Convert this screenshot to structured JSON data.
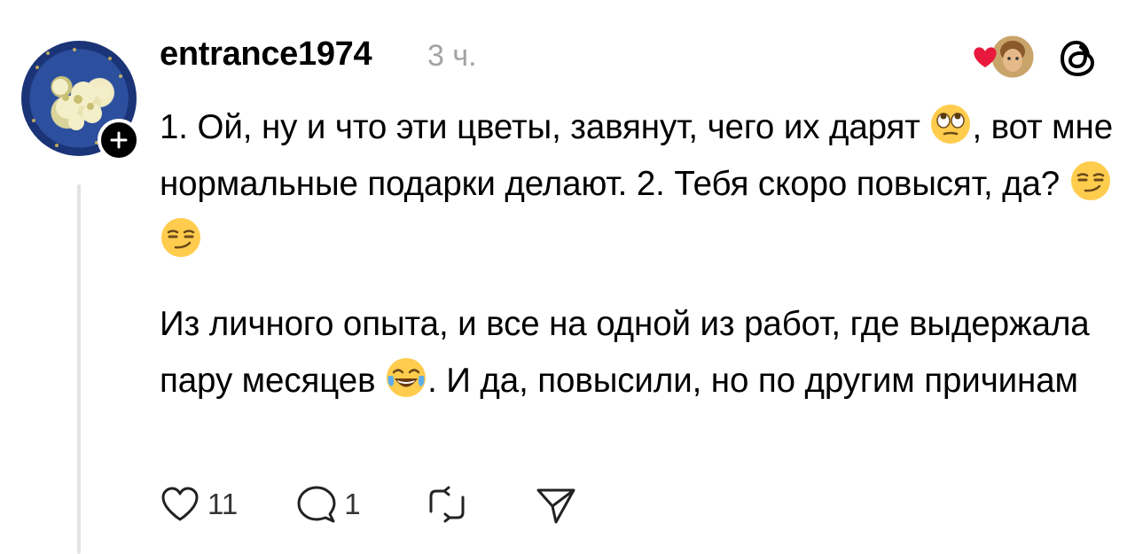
{
  "post": {
    "username": "entrance1974",
    "time": "3 ч.",
    "paragraph1": {
      "part1": "1. Ой, ну и что эти цветы, завянут, чего их дарят",
      "part2": ", вот мне нормальные подарки делают. 2. Тебя скоро повысят, да?"
    },
    "paragraph2": {
      "part1": "Из личного опыта, и все на одной из работ, где выдержала пару месяцев",
      "part2": ". И да, повысили, но по другим причинам"
    }
  },
  "actions": {
    "likes": "11",
    "replies": "1"
  },
  "icons": {
    "like": "heart-icon",
    "reply": "comment-icon",
    "repost": "repost-icon",
    "share": "send-icon",
    "follow": "plus-icon",
    "app": "threads-logo-icon"
  },
  "colors": {
    "heart": "#e8193c",
    "muted": "#a3a3a3",
    "thread_line": "#e3e3e3"
  }
}
